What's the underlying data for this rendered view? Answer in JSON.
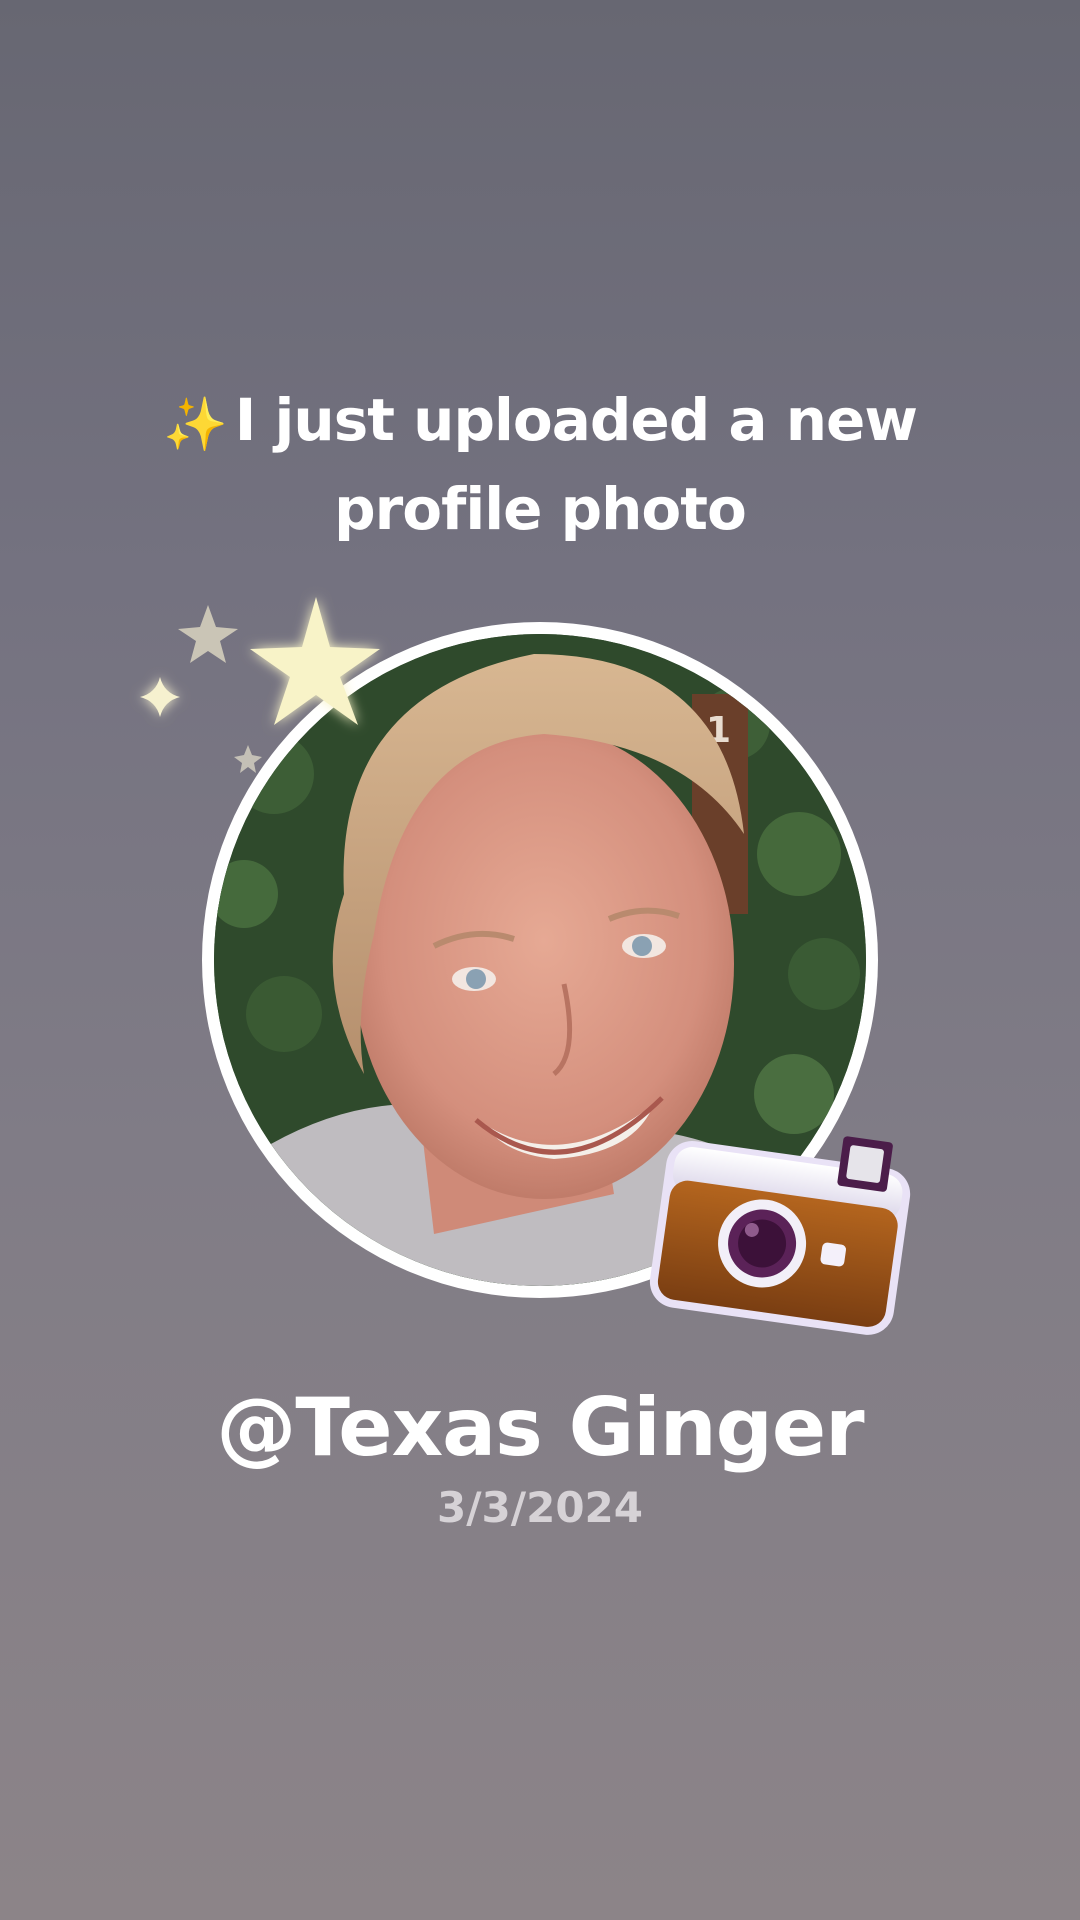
{
  "post": {
    "sparkle_emoji": "✨",
    "headline": "I just uploaded a new profile photo",
    "username": "@Texas Ginger",
    "date": "3/3/2024"
  },
  "icons": {
    "sparkles": "sparkles-icon",
    "stars": "stars-decoration-icon",
    "camera": "camera-icon"
  },
  "colors": {
    "background_top": "#676772",
    "background_bottom": "#8c8488",
    "text": "#ffffff",
    "date_text": "#d6d2d6"
  }
}
